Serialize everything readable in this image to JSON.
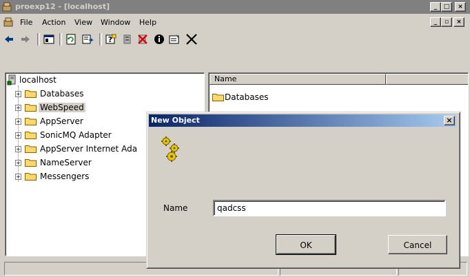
{
  "window": {
    "title": "proexp12 - [localhost]",
    "controls": [
      "_",
      "□",
      "×"
    ]
  },
  "menu": {
    "items": [
      "File",
      "Action",
      "View",
      "Window",
      "Help"
    ],
    "mdi_controls": [
      "_",
      "▫",
      "×"
    ]
  },
  "tree": {
    "root": "localhost",
    "items": [
      "Databases",
      "WebSpeed",
      "AppServer",
      "SonicMQ Adapter",
      "AppServer Internet Ada",
      "NameServer",
      "Messengers"
    ]
  },
  "list": {
    "column_headers": [
      "Name",
      ""
    ],
    "rows": [
      "Databases"
    ]
  },
  "dialog": {
    "title": "New Object",
    "close_glyph": "×",
    "name_label": "Name",
    "name_value": "qadcss",
    "ok_label": "OK",
    "cancel_label": "Cancel"
  },
  "colors": {
    "title_active_start": "#0a246a",
    "title_active_end": "#a6caf0",
    "title_inactive": "#808080",
    "face": "#d4d0c8",
    "folder": "#ffd86b"
  }
}
